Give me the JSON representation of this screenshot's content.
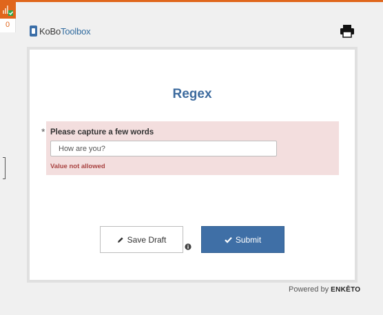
{
  "queue": {
    "count": "0"
  },
  "header": {
    "logo_part1": "KoBo",
    "logo_part2": "Toolbox"
  },
  "form": {
    "title": "Regex",
    "required_mark": "*",
    "question": {
      "label": "Please capture a few words",
      "value": "How are you?",
      "error": "Value not allowed"
    },
    "buttons": {
      "save_draft": "Save Draft",
      "submit": "Submit"
    }
  },
  "footer": {
    "powered_by": "Powered by",
    "brand": "ENKĒTO"
  },
  "icons": {
    "queue": "queue-status-icon",
    "print": "printer-icon",
    "pencil": "pencil-icon",
    "info": "info-icon",
    "check": "check-icon"
  },
  "colors": {
    "accent": "#e0661c",
    "primary": "#3f6fa6",
    "title": "#3d6b9e",
    "invalid_bg": "#f3dede",
    "error_text": "#a94442"
  }
}
